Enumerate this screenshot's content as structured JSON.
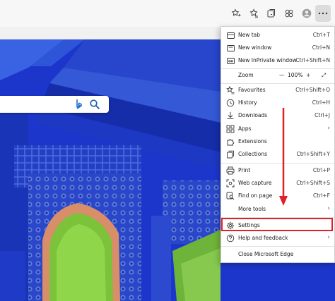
{
  "toolbar": {
    "icons": [
      "favorite-star-icon",
      "favorites-list-icon",
      "collections-icon",
      "profile-icon",
      "more-icon"
    ]
  },
  "menu": {
    "items": [
      {
        "label": "New tab",
        "shortcut": "Ctrl+T",
        "icon": "new-tab-icon"
      },
      {
        "label": "New window",
        "shortcut": "Ctrl+N",
        "icon": "new-window-icon"
      },
      {
        "label": "New InPrivate window",
        "shortcut": "Ctrl+Shift+N",
        "icon": "inprivate-icon"
      },
      {
        "label": "Zoom",
        "minus": "—",
        "value": "100%",
        "plus": "+",
        "expand": "⤢"
      },
      {
        "label": "Favourites",
        "shortcut": "Ctrl+Shift+O",
        "icon": "favourites-icon"
      },
      {
        "label": "History",
        "shortcut": "Ctrl+H",
        "icon": "history-icon"
      },
      {
        "label": "Downloads",
        "shortcut": "Ctrl+J",
        "icon": "download-icon"
      },
      {
        "label": "Apps",
        "shortcut": "",
        "icon": "apps-icon"
      },
      {
        "label": "Extensions",
        "shortcut": "",
        "icon": "extensions-icon"
      },
      {
        "label": "Collections",
        "shortcut": "Ctrl+Shift+Y",
        "icon": "collections-icon"
      },
      {
        "label": "Print",
        "shortcut": "Ctrl+P",
        "icon": "print-icon"
      },
      {
        "label": "Web capture",
        "shortcut": "Ctrl+Shift+S",
        "icon": "web-capture-icon"
      },
      {
        "label": "Find on page",
        "shortcut": "Ctrl+F",
        "icon": "find-icon"
      },
      {
        "label": "More tools",
        "shortcut": "",
        "icon": ""
      },
      {
        "label": "Settings",
        "shortcut": "",
        "icon": "gear-icon"
      },
      {
        "label": "Help and feedback",
        "shortcut": "",
        "icon": "help-icon"
      },
      {
        "label": "Close Microsoft Edge",
        "shortcut": "",
        "icon": ""
      }
    ]
  },
  "colors": {
    "highlight": "#e0202a",
    "wall_blue": "#1f3fd6",
    "arch_green": "#7cc23a"
  }
}
